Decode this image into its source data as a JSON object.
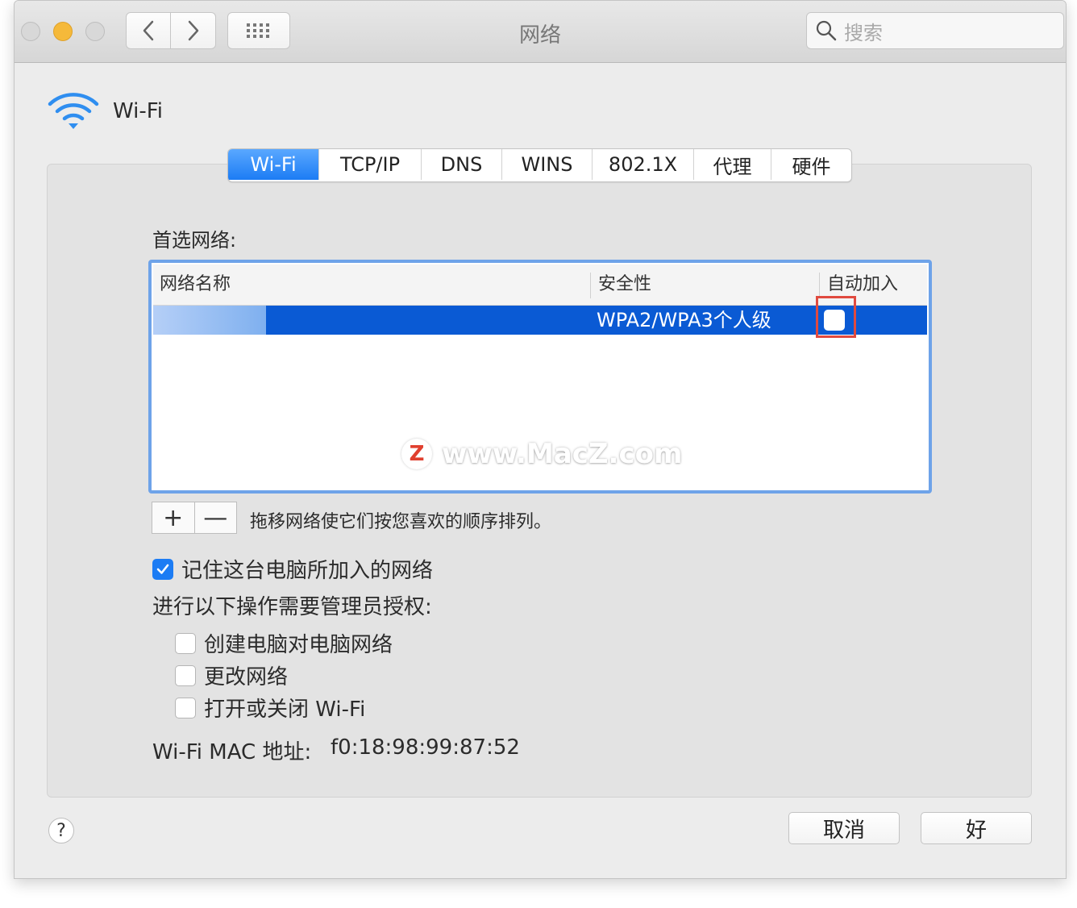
{
  "window": {
    "title": "网络"
  },
  "search": {
    "placeholder": "搜索"
  },
  "header": {
    "title": "Wi-Fi"
  },
  "tabs": [
    {
      "label": "Wi-Fi",
      "active": true
    },
    {
      "label": "TCP/IP"
    },
    {
      "label": "DNS"
    },
    {
      "label": "WINS"
    },
    {
      "label": "802.1X"
    },
    {
      "label": "代理"
    },
    {
      "label": "硬件"
    }
  ],
  "preferred": {
    "label": "首选网络:",
    "columns": [
      "网络名称",
      "安全性",
      "自动加入"
    ],
    "rows": [
      {
        "name": "",
        "security": "WPA2/WPA3个人级",
        "auto_join": false,
        "selected": true
      }
    ],
    "hint": "拖移网络使它们按您喜欢的顺序排列。",
    "add": "+",
    "remove": "—"
  },
  "watermark": {
    "logo": "Z",
    "text": "www.MacZ.com"
  },
  "options": {
    "remember": {
      "label": "记住这台电脑所加入的网络",
      "checked": true
    },
    "admin_label": "进行以下操作需要管理员授权:",
    "create_computer": {
      "label": "创建电脑对电脑网络",
      "checked": false
    },
    "change_network": {
      "label": "更改网络",
      "checked": false
    },
    "toggle_wifi": {
      "label": "打开或关闭 Wi-Fi",
      "checked": false
    }
  },
  "mac": {
    "label": "Wi-Fi MAC 地址:",
    "value": "f0:18:98:99:87:52"
  },
  "buttons": {
    "help": "?",
    "cancel": "取消",
    "ok": "好"
  },
  "colors": {
    "accent": "#1c7cf4",
    "selection": "#0a5ad4",
    "highlight": "#e04a3f"
  }
}
